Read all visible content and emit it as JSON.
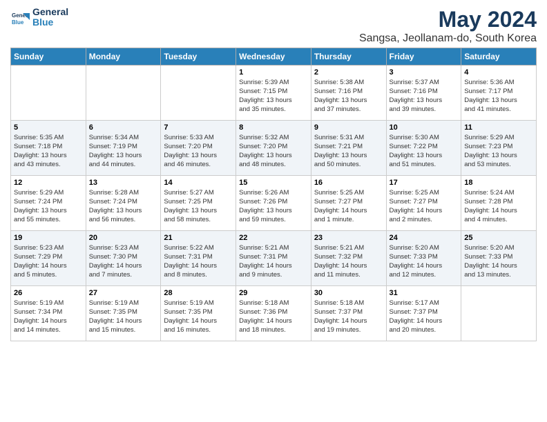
{
  "header": {
    "logo_line1": "General",
    "logo_line2": "Blue",
    "title": "May 2024",
    "subtitle": "Sangsa, Jeollanam-do, South Korea"
  },
  "days_of_week": [
    "Sunday",
    "Monday",
    "Tuesday",
    "Wednesday",
    "Thursday",
    "Friday",
    "Saturday"
  ],
  "weeks": [
    [
      {
        "day": "",
        "info": ""
      },
      {
        "day": "",
        "info": ""
      },
      {
        "day": "",
        "info": ""
      },
      {
        "day": "1",
        "info": "Sunrise: 5:39 AM\nSunset: 7:15 PM\nDaylight: 13 hours\nand 35 minutes."
      },
      {
        "day": "2",
        "info": "Sunrise: 5:38 AM\nSunset: 7:16 PM\nDaylight: 13 hours\nand 37 minutes."
      },
      {
        "day": "3",
        "info": "Sunrise: 5:37 AM\nSunset: 7:16 PM\nDaylight: 13 hours\nand 39 minutes."
      },
      {
        "day": "4",
        "info": "Sunrise: 5:36 AM\nSunset: 7:17 PM\nDaylight: 13 hours\nand 41 minutes."
      }
    ],
    [
      {
        "day": "5",
        "info": "Sunrise: 5:35 AM\nSunset: 7:18 PM\nDaylight: 13 hours\nand 43 minutes."
      },
      {
        "day": "6",
        "info": "Sunrise: 5:34 AM\nSunset: 7:19 PM\nDaylight: 13 hours\nand 44 minutes."
      },
      {
        "day": "7",
        "info": "Sunrise: 5:33 AM\nSunset: 7:20 PM\nDaylight: 13 hours\nand 46 minutes."
      },
      {
        "day": "8",
        "info": "Sunrise: 5:32 AM\nSunset: 7:20 PM\nDaylight: 13 hours\nand 48 minutes."
      },
      {
        "day": "9",
        "info": "Sunrise: 5:31 AM\nSunset: 7:21 PM\nDaylight: 13 hours\nand 50 minutes."
      },
      {
        "day": "10",
        "info": "Sunrise: 5:30 AM\nSunset: 7:22 PM\nDaylight: 13 hours\nand 51 minutes."
      },
      {
        "day": "11",
        "info": "Sunrise: 5:29 AM\nSunset: 7:23 PM\nDaylight: 13 hours\nand 53 minutes."
      }
    ],
    [
      {
        "day": "12",
        "info": "Sunrise: 5:29 AM\nSunset: 7:24 PM\nDaylight: 13 hours\nand 55 minutes."
      },
      {
        "day": "13",
        "info": "Sunrise: 5:28 AM\nSunset: 7:24 PM\nDaylight: 13 hours\nand 56 minutes."
      },
      {
        "day": "14",
        "info": "Sunrise: 5:27 AM\nSunset: 7:25 PM\nDaylight: 13 hours\nand 58 minutes."
      },
      {
        "day": "15",
        "info": "Sunrise: 5:26 AM\nSunset: 7:26 PM\nDaylight: 13 hours\nand 59 minutes."
      },
      {
        "day": "16",
        "info": "Sunrise: 5:25 AM\nSunset: 7:27 PM\nDaylight: 14 hours\nand 1 minute."
      },
      {
        "day": "17",
        "info": "Sunrise: 5:25 AM\nSunset: 7:27 PM\nDaylight: 14 hours\nand 2 minutes."
      },
      {
        "day": "18",
        "info": "Sunrise: 5:24 AM\nSunset: 7:28 PM\nDaylight: 14 hours\nand 4 minutes."
      }
    ],
    [
      {
        "day": "19",
        "info": "Sunrise: 5:23 AM\nSunset: 7:29 PM\nDaylight: 14 hours\nand 5 minutes."
      },
      {
        "day": "20",
        "info": "Sunrise: 5:23 AM\nSunset: 7:30 PM\nDaylight: 14 hours\nand 7 minutes."
      },
      {
        "day": "21",
        "info": "Sunrise: 5:22 AM\nSunset: 7:31 PM\nDaylight: 14 hours\nand 8 minutes."
      },
      {
        "day": "22",
        "info": "Sunrise: 5:21 AM\nSunset: 7:31 PM\nDaylight: 14 hours\nand 9 minutes."
      },
      {
        "day": "23",
        "info": "Sunrise: 5:21 AM\nSunset: 7:32 PM\nDaylight: 14 hours\nand 11 minutes."
      },
      {
        "day": "24",
        "info": "Sunrise: 5:20 AM\nSunset: 7:33 PM\nDaylight: 14 hours\nand 12 minutes."
      },
      {
        "day": "25",
        "info": "Sunrise: 5:20 AM\nSunset: 7:33 PM\nDaylight: 14 hours\nand 13 minutes."
      }
    ],
    [
      {
        "day": "26",
        "info": "Sunrise: 5:19 AM\nSunset: 7:34 PM\nDaylight: 14 hours\nand 14 minutes."
      },
      {
        "day": "27",
        "info": "Sunrise: 5:19 AM\nSunset: 7:35 PM\nDaylight: 14 hours\nand 15 minutes."
      },
      {
        "day": "28",
        "info": "Sunrise: 5:19 AM\nSunset: 7:35 PM\nDaylight: 14 hours\nand 16 minutes."
      },
      {
        "day": "29",
        "info": "Sunrise: 5:18 AM\nSunset: 7:36 PM\nDaylight: 14 hours\nand 18 minutes."
      },
      {
        "day": "30",
        "info": "Sunrise: 5:18 AM\nSunset: 7:37 PM\nDaylight: 14 hours\nand 19 minutes."
      },
      {
        "day": "31",
        "info": "Sunrise: 5:17 AM\nSunset: 7:37 PM\nDaylight: 14 hours\nand 20 minutes."
      },
      {
        "day": "",
        "info": ""
      }
    ]
  ]
}
